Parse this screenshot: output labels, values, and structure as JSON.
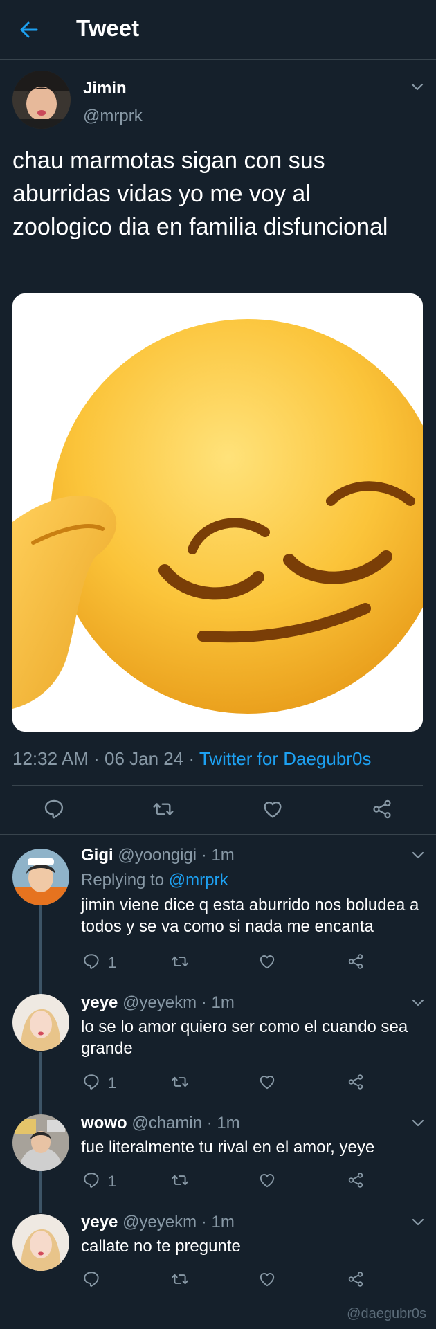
{
  "header": {
    "back_icon": "arrow-left-icon",
    "title": "Tweet",
    "accent": "#1da1f2"
  },
  "tweet": {
    "name": "Jimin",
    "handle": "@mrprk",
    "text": "chau marmotas sigan con sus aburridas vidas yo me voy al zoologico dia en familia disfuncional",
    "media": "saluting-smirk-emoji",
    "time": "12:32 AM",
    "date": "06 Jan 24",
    "source": "Twitter for Daegubr0s",
    "actions": [
      "reply-icon",
      "retweet-icon",
      "like-icon",
      "share-icon"
    ]
  },
  "replies": [
    {
      "name": "Gigi",
      "handle": "@yoongigi",
      "time": "1m",
      "replying_label": "Replying to",
      "replying_to": "@mrprk",
      "text": "jimin viene dice q esta aburrido nos boludea a todos y se va como si nada me encanta",
      "reply_count": "1"
    },
    {
      "name": "yeye",
      "handle": "@yeyekm",
      "time": "1m",
      "text": "lo se lo amor quiero ser como el cuando sea grande",
      "reply_count": "1"
    },
    {
      "name": "wowo",
      "handle": "@chamin",
      "time": "1m",
      "text": "fue literalmente tu rival en el amor, yeye",
      "reply_count": "1"
    },
    {
      "name": "yeye",
      "handle": "@yeyekm",
      "time": "1m",
      "text": "callate no te pregunte",
      "reply_count": ""
    }
  ],
  "watermark": "@daegubr0s",
  "colors": {
    "background": "#15202b",
    "secondary_text": "#8899a6",
    "divider": "#38444d",
    "link": "#1da1f2"
  }
}
